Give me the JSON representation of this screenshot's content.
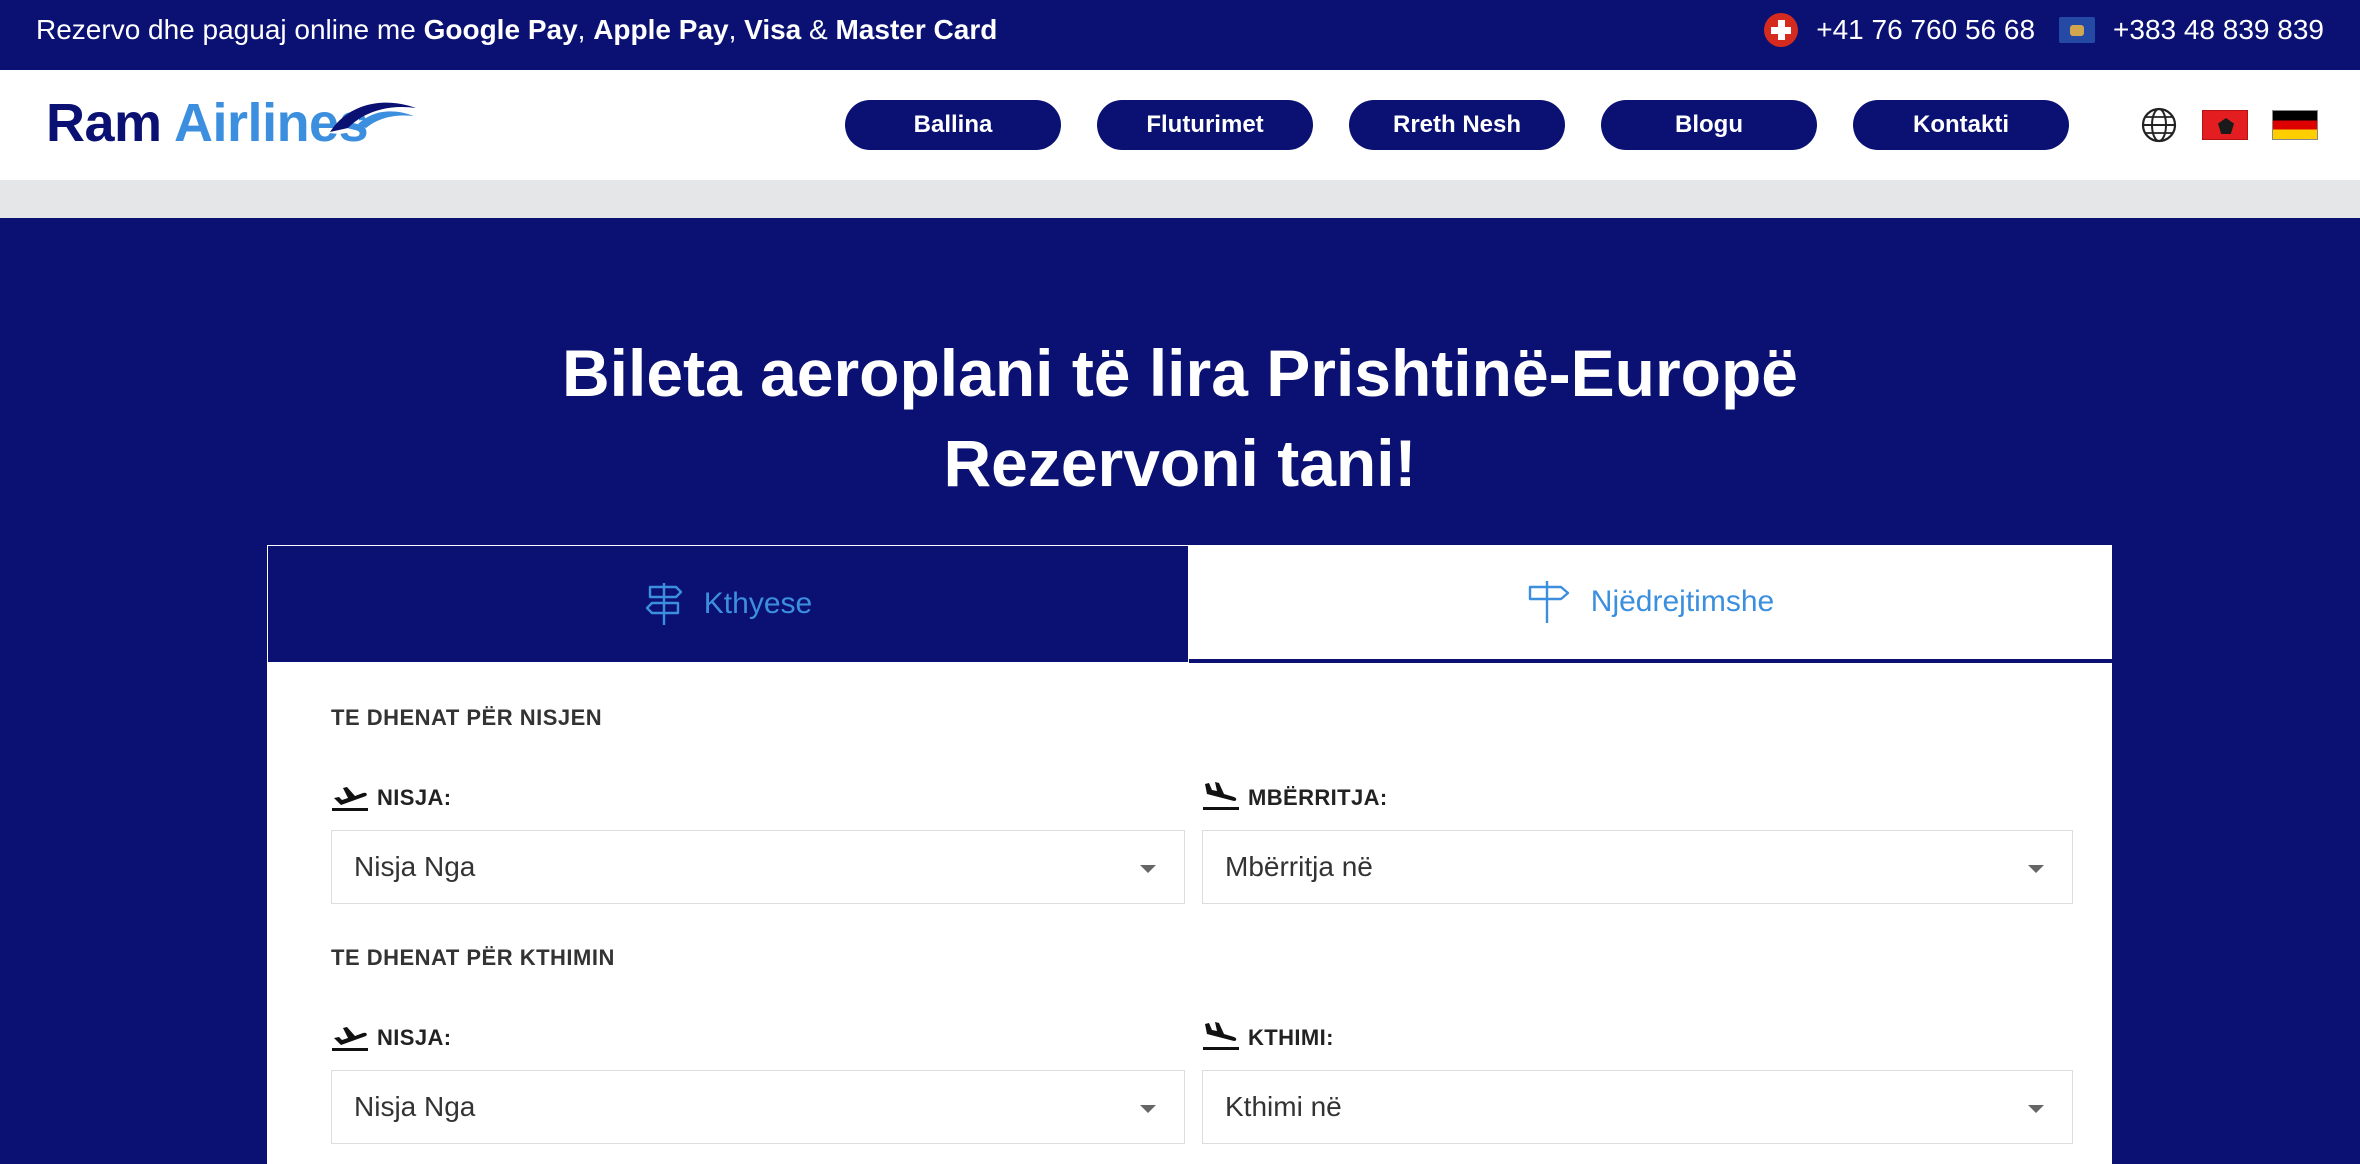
{
  "topbar": {
    "promo_prefix": "Rezervo dhe paguaj online me ",
    "pay1": "Google Pay",
    "sep1": ", ",
    "pay2": "Apple Pay",
    "sep2": ", ",
    "pay3": "Visa",
    "sep3": " & ",
    "pay4": "Master Card",
    "phone_ch": "+41 76 760 56 68",
    "phone_xk": "+383 48 839 839"
  },
  "header": {
    "logo_part1": "Ram",
    "logo_part2": "Airlines",
    "nav": [
      "Ballina",
      "Fluturimet",
      "Rreth Nesh",
      "Blogu",
      "Kontakti"
    ]
  },
  "hero": {
    "title_line1": "Bileta aeroplani të lira Prishtinë-Europë",
    "title_line2": "Rezervoni tani!"
  },
  "booking": {
    "tabs": [
      {
        "label": "Kthyese",
        "icon": "signpost-two-way-icon"
      },
      {
        "label": "Njëdrejtimshe",
        "icon": "signpost-one-way-icon"
      }
    ],
    "outbound": {
      "section_title": "TE DHENAT PËR NISJEN",
      "from_label": "NISJA:",
      "from_value": "Nisja Nga",
      "to_label": "MBËRRITJA:",
      "to_value": "Mbërritja në"
    },
    "return": {
      "section_title": "TE DHENAT PËR KTHIMIN",
      "from_label": "NISJA:",
      "from_value": "Nisja Nga",
      "to_label": "KTHIMI:",
      "to_value": "Kthimi në"
    }
  },
  "colors": {
    "navy": "#0a1172",
    "accent_blue": "#3c8fde",
    "header_bg": "#ffffff",
    "gray_band": "#e5e6e8"
  }
}
